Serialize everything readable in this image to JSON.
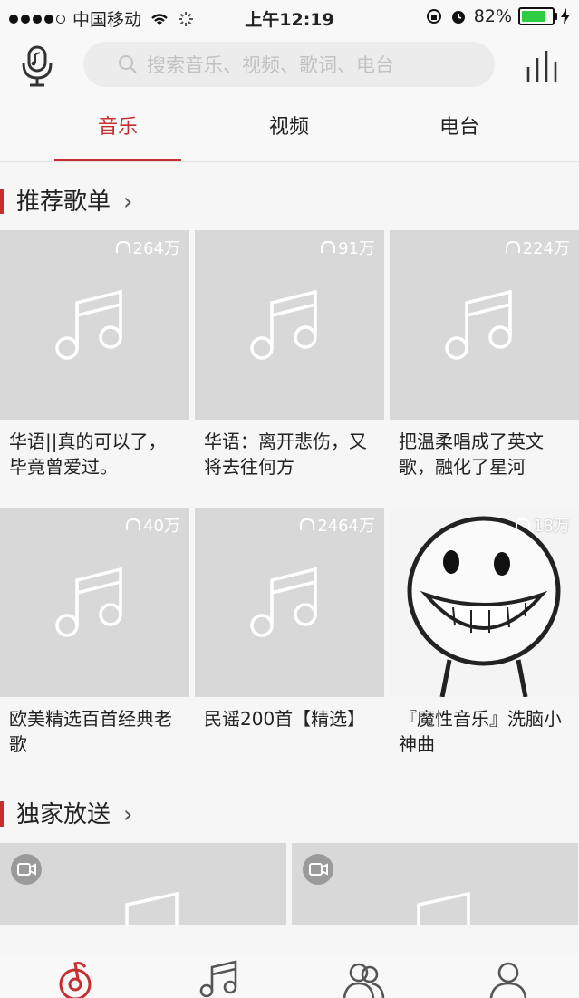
{
  "status_bar": {
    "carrier": "中国移动",
    "time": "上午12:19",
    "battery": "82%",
    "battery_level": 0.82
  },
  "search": {
    "placeholder": "搜索音乐、视频、歌词、电台"
  },
  "tabs": [
    {
      "label": "音乐",
      "active": true
    },
    {
      "label": "视频",
      "active": false
    },
    {
      "label": "电台",
      "active": false
    }
  ],
  "sections": {
    "recommended": {
      "title": "推荐歌单",
      "playlists": [
        {
          "count": "264万",
          "title": "华语||真的可以了，毕竟曾爱过。"
        },
        {
          "count": "91万",
          "title": "华语：离开悲伤，又将去往何方"
        },
        {
          "count": "224万",
          "title": "把温柔唱成了英文歌，融化了星河"
        },
        {
          "count": "40万",
          "title": "欧美精选百首经典老歌"
        },
        {
          "count": "2464万",
          "title": "民谣200首【精选】"
        },
        {
          "count": "18万",
          "title": "『魔性音乐』洗脑小神曲"
        }
      ]
    },
    "exclusive": {
      "title": "独家放送"
    }
  },
  "colors": {
    "accent": "#c62f2f",
    "placeholder_gray": "#d8d8d8"
  },
  "icons": {
    "mic": "microphone-icon",
    "search": "search-icon",
    "equalizer": "equalizer-icon",
    "headphones": "headphones-icon",
    "music_note": "music-note-icon",
    "video": "video-camera-icon"
  }
}
